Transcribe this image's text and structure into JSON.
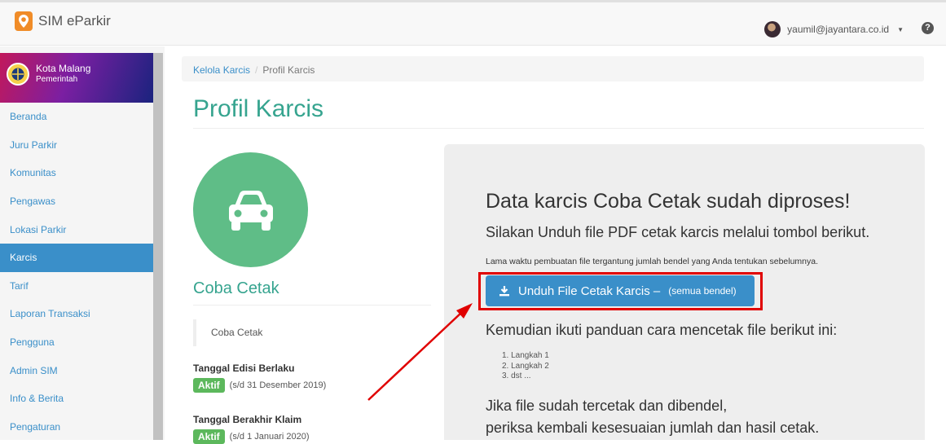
{
  "app": {
    "name": "SIM eParkir",
    "logo_icon": "location-pin-icon",
    "accent": "#f08c28"
  },
  "user": {
    "email": "yaumil@jayantara.co.id"
  },
  "sidebar": {
    "org_name": "Kota Malang",
    "org_type": "Pemerintah",
    "items": [
      {
        "label": "Beranda",
        "active": false
      },
      {
        "label": "Juru Parkir",
        "active": false
      },
      {
        "label": "Komunitas",
        "active": false
      },
      {
        "label": "Pengawas",
        "active": false
      },
      {
        "label": "Lokasi Parkir",
        "active": false
      },
      {
        "label": "Karcis",
        "active": true
      },
      {
        "label": "Tarif",
        "active": false
      },
      {
        "label": "Laporan Transaksi",
        "active": false
      },
      {
        "label": "Pengguna",
        "active": false
      },
      {
        "label": "Admin SIM",
        "active": false
      },
      {
        "label": "Info & Berita",
        "active": false
      },
      {
        "label": "Pengaturan",
        "active": false
      }
    ]
  },
  "breadcrumb": {
    "parent": "Kelola Karcis",
    "separator": "/",
    "current": "Profil Karcis"
  },
  "page": {
    "title": "Profil Karcis"
  },
  "profile": {
    "icon": "car-icon",
    "name": "Coba Cetak",
    "description": "Coba Cetak",
    "edition_label": "Tanggal Edisi Berlaku",
    "edition_status": "Aktif",
    "edition_date": "(s/d 31 Desember 2019)",
    "claim_label": "Tanggal Berakhir Klaim",
    "claim_status": "Aktif",
    "claim_date": "(s/d 1 Januari 2020)"
  },
  "panel": {
    "title": "Data karcis Coba Cetak sudah diproses!",
    "lead": "Silakan Unduh file PDF cetak karcis melalui tombol berikut.",
    "note": "Lama waktu pembuatan file tergantung jumlah bendel yang Anda tentukan sebelumnya.",
    "button_label": "Unduh File Cetak Karcis –",
    "button_small": "(semua bendel)",
    "subheading": "Kemudian ikuti panduan cara mencetak file berikut ini:",
    "steps": [
      "1. Langkah 1",
      "2. Langkah 2",
      "3. dst ..."
    ],
    "footer_line1": "Jika file sudah tercetak dan dibendel,",
    "footer_line2": "periksa kembali kesesuaian jumlah dan hasil cetak."
  },
  "colors": {
    "primary": "#3a8fc9",
    "title": "#36a48f",
    "success": "#5cb85c",
    "highlight": "#e00000"
  }
}
